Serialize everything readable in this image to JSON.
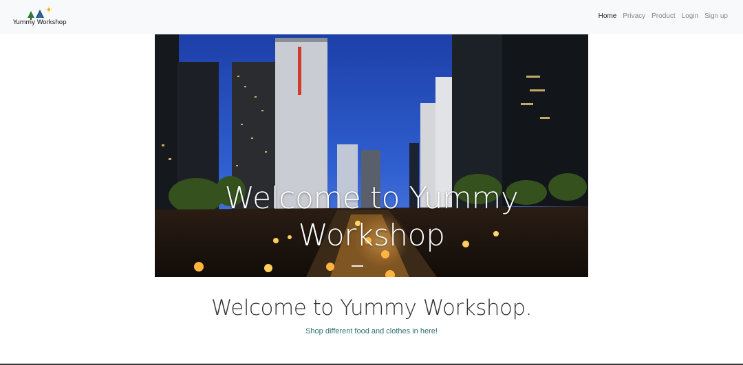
{
  "navbar": {
    "brand_text": "Yummy Workshop",
    "brand_logo_icon": "trees-and-sun-icon",
    "links": [
      {
        "label": "Home",
        "active": true
      },
      {
        "label": "Privacy",
        "active": false
      },
      {
        "label": "Product",
        "active": false
      },
      {
        "label": "Login",
        "active": false
      },
      {
        "label": "Sign up",
        "active": false
      }
    ]
  },
  "hero": {
    "caption_line1": "Welcome to Yummy",
    "caption_line2": "Workshop",
    "image_subject": "night-city-stream-lanterns",
    "active_slide": 1
  },
  "main": {
    "heading": "Welcome to Yummy Workshop.",
    "subheading": "Shop different food and clothes in here!"
  },
  "colors": {
    "navbar_bg": "#f8f9fa",
    "nav_active": "#222222",
    "nav_inactive": "#888888",
    "sub_text": "#2e6f74"
  }
}
